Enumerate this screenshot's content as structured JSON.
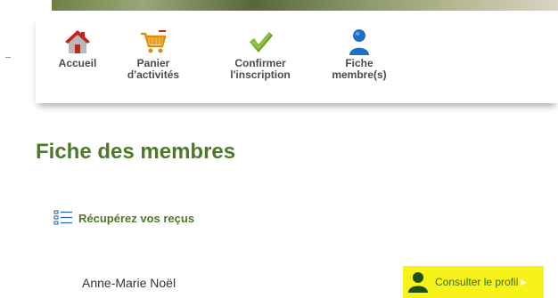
{
  "nav": {
    "items": [
      {
        "label": "Accueil",
        "icon": "home-icon"
      },
      {
        "label": "Panier\nd'activités",
        "icon": "cart-icon"
      },
      {
        "label": "Confirmer\nl'inscription",
        "icon": "checkmark-icon"
      },
      {
        "label": "Fiche\nmembre(s)",
        "icon": "user-icon"
      }
    ]
  },
  "main": {
    "title": "Fiche des membres",
    "receipts_link": "Récupérez vos reçus",
    "member": {
      "name": "Anne-Marie Noël",
      "profile_button": "Consulter le profil"
    }
  },
  "colors": {
    "accent_green": "#4c7a27",
    "highlight_yellow": "#f7f21a",
    "icon_blue": "#1f6fc4",
    "icon_red": "#c4231c",
    "icon_orange": "#e08a0b"
  }
}
